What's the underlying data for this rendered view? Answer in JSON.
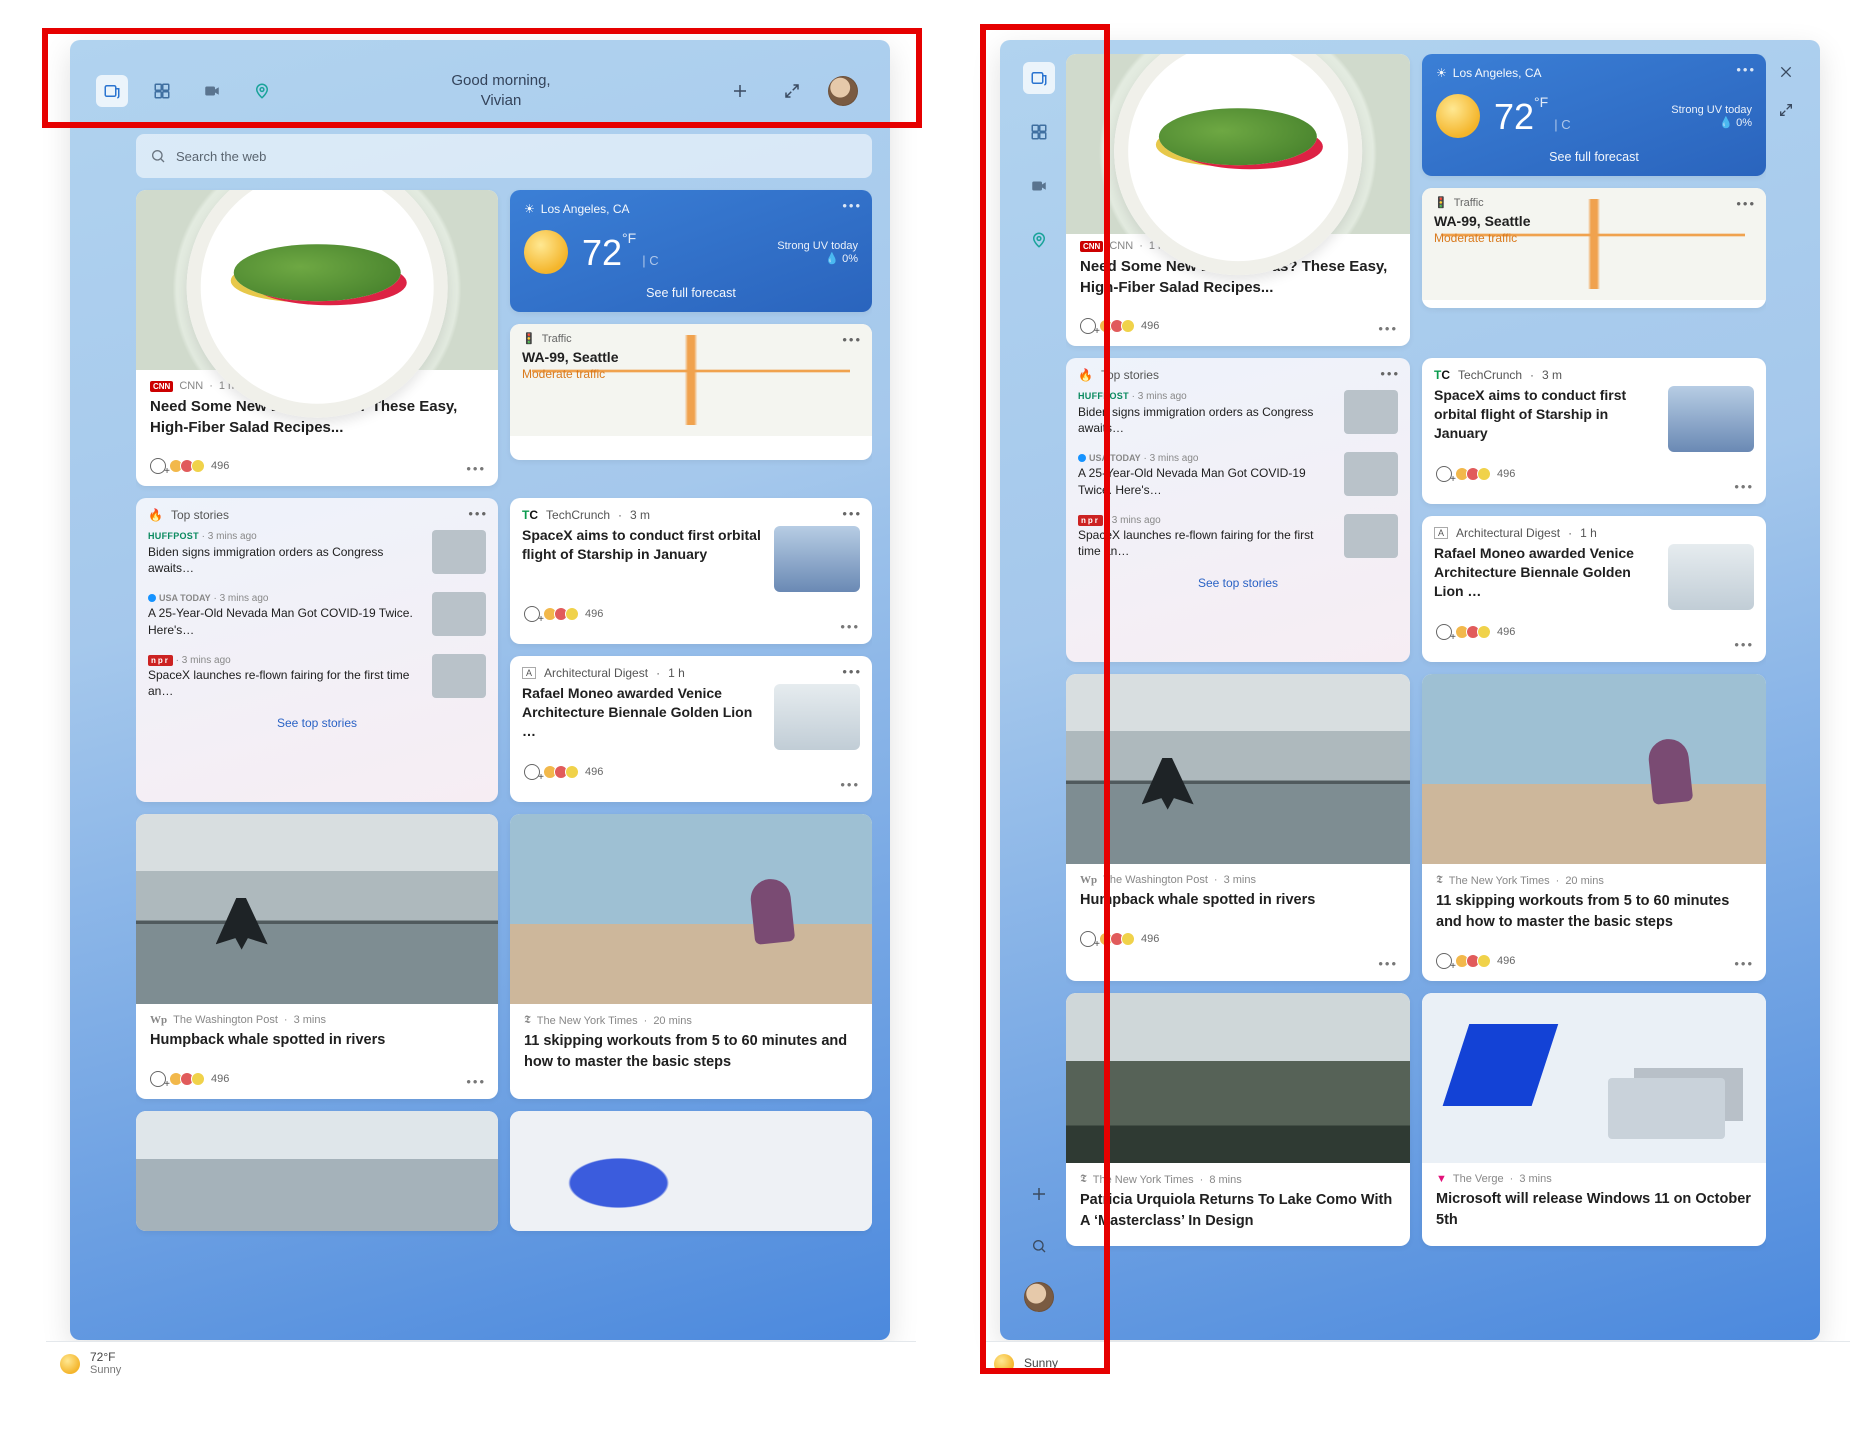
{
  "left": {
    "greeting_line1": "Good morning,",
    "greeting_line2": "Vivian",
    "search_placeholder": "Search the web",
    "weather": {
      "location": "Los Angeles, CA",
      "temp": "72",
      "deg": "°F",
      "unit_alt": "C",
      "uv": "Strong UV today",
      "precip": "💧 0%",
      "forecast_link": "See full forecast"
    },
    "lunch": {
      "source": "CNN",
      "time": "1 h",
      "title": "Need Some New Lunch Ideas? These Easy, High-Fiber Salad Recipes...",
      "reactions": "496"
    },
    "traffic": {
      "label": "Traffic",
      "route": "WA-99, Seattle",
      "status": "Moderate traffic"
    },
    "topstories": {
      "label": "Top stories",
      "items": [
        {
          "src": "HUFFPOST",
          "time": "3 mins ago",
          "title": "Biden signs immigration orders as Congress awaits…"
        },
        {
          "src": "USA TODAY",
          "time": "3 mins ago",
          "title": "A 25-Year-Old Nevada Man Got COVID-19 Twice. Here's…"
        },
        {
          "src": "npr",
          "time": "3 mins ago",
          "title": "SpaceX launches re-flown fairing for the first time an…"
        }
      ],
      "see_more": "See top stories"
    },
    "techcrunch": {
      "source": "TechCrunch",
      "time": "3 m",
      "title": "SpaceX aims to conduct first orbital flight of Starship in January",
      "reactions": "496"
    },
    "archdigest": {
      "source": "Architectural Digest",
      "time": "1 h",
      "title": "Rafael Moneo awarded Venice Architecture Biennale Golden Lion …",
      "reactions": "496"
    },
    "whale": {
      "source": "The Washington Post",
      "time": "3 mins",
      "title": "Humpback whale spotted in rivers",
      "reactions": "496"
    },
    "workout": {
      "source": "The New York Times",
      "time": "20 mins",
      "title": "11 skipping workouts from 5 to 60 minutes and how to master the basic steps"
    },
    "taskbar": {
      "temp": "72°F",
      "cond": "Sunny"
    }
  },
  "right": {
    "weather": {
      "location": "Los Angeles, CA",
      "temp": "72",
      "deg": "°F",
      "unit_alt": "C",
      "uv": "Strong UV today",
      "precip": "💧 0%",
      "forecast_link": "See full forecast"
    },
    "lunch": {
      "source": "CNN",
      "time": "1 h",
      "title": "Need Some New Lunch Ideas? These Easy, High-Fiber Salad Recipes...",
      "reactions": "496"
    },
    "traffic": {
      "label": "Traffic",
      "route": "WA-99, Seattle",
      "status": "Moderate traffic"
    },
    "topstories": {
      "label": "Top stories",
      "items": [
        {
          "src": "HUFFPOST",
          "time": "3 mins ago",
          "title": "Biden signs immigration orders as Congress awaits…"
        },
        {
          "src": "USA TODAY",
          "time": "3 mins ago",
          "title": "A 25-Year-Old Nevada Man Got COVID-19 Twice. Here's…"
        },
        {
          "src": "npr",
          "time": "3 mins ago",
          "title": "SpaceX launches re-flown fairing for the first time an…"
        }
      ],
      "see_more": "See top stories"
    },
    "techcrunch": {
      "source": "TechCrunch",
      "time": "3 m",
      "title": "SpaceX aims to conduct first orbital flight of Starship in January",
      "reactions": "496"
    },
    "archdigest": {
      "source": "Architectural Digest",
      "time": "1 h",
      "title": "Rafael Moneo awarded Venice Architecture Biennale Golden Lion …",
      "reactions": "496"
    },
    "whale": {
      "source": "The Washington Post",
      "time": "3 mins",
      "title": "Humpback whale spotted in rivers",
      "reactions": "496"
    },
    "workout": {
      "source": "The New York Times",
      "time": "20 mins",
      "title": "11 skipping workouts from 5 to 60 minutes and how to master the basic steps",
      "reactions": "496"
    },
    "urquiola": {
      "source": "The New York Times",
      "time": "8 mins",
      "title": "Patricia Urquiola Returns To Lake Como With A ‘Masterclass’ In Design"
    },
    "verge": {
      "source": "The Verge",
      "time": "3 mins",
      "title": "Microsoft will release Windows 11 on October 5th"
    },
    "taskbar": {
      "cond": "Sunny"
    }
  },
  "icons": {
    "news": "news-icon",
    "widgets": "widgets-icon",
    "video": "video-icon",
    "map_pin": "map-pin-icon",
    "plus": "plus-icon",
    "expand": "expand-icon",
    "close": "close-icon",
    "search": "search-icon",
    "more": "more-icon",
    "traffic": "traffic-icon"
  }
}
